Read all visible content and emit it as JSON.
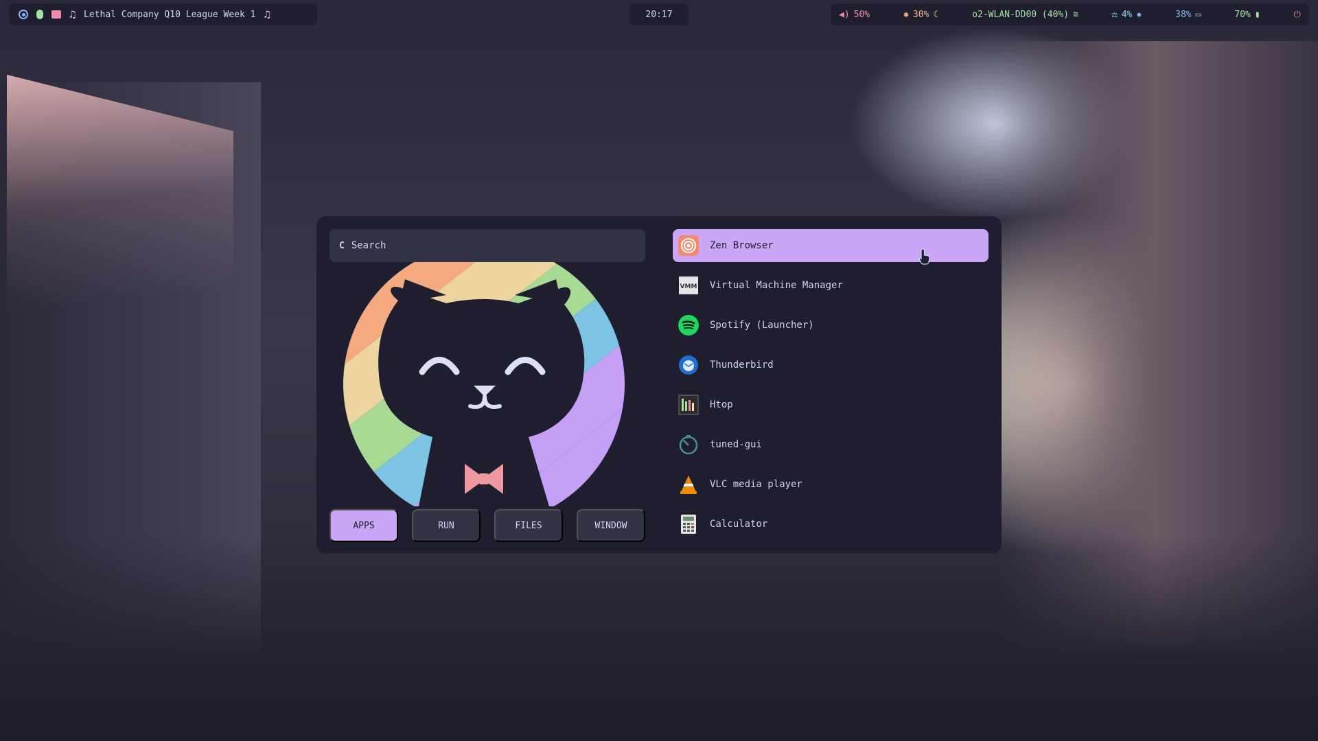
{
  "topbar": {
    "workspaces": [
      "circle-dot-icon",
      "leaf-icon",
      "bus-icon"
    ],
    "media": {
      "title": "Lethal Company Q10 League Week 1"
    },
    "clock": "20:17",
    "status": {
      "volume": "50%",
      "cpu": "30%",
      "wifi": "o2-WLAN-DD00 (40%)",
      "memory": "4%",
      "brightness": "38%",
      "battery": "70%"
    }
  },
  "launcher": {
    "search": {
      "placeholder": "Search",
      "glyph": "C"
    },
    "modes": [
      {
        "label": "APPS",
        "active": true
      },
      {
        "label": "RUN",
        "active": false
      },
      {
        "label": "FILES",
        "active": false
      },
      {
        "label": "WINDOW",
        "active": false
      }
    ],
    "apps": [
      {
        "label": "Zen Browser",
        "icon": "zen-browser-icon",
        "selected": true
      },
      {
        "label": "Virtual Machine Manager",
        "icon": "virt-manager-icon"
      },
      {
        "label": "Spotify (Launcher)",
        "icon": "spotify-icon"
      },
      {
        "label": "Thunderbird",
        "icon": "thunderbird-icon"
      },
      {
        "label": "Htop",
        "icon": "htop-icon"
      },
      {
        "label": "tuned-gui",
        "icon": "tuned-icon"
      },
      {
        "label": "VLC media player",
        "icon": "vlc-icon"
      },
      {
        "label": "Calculator",
        "icon": "calculator-icon"
      }
    ]
  },
  "colors": {
    "accent": "#cba6f7",
    "surface": "#313244",
    "base": "#1e1e2e",
    "text": "#cdd6f4"
  }
}
